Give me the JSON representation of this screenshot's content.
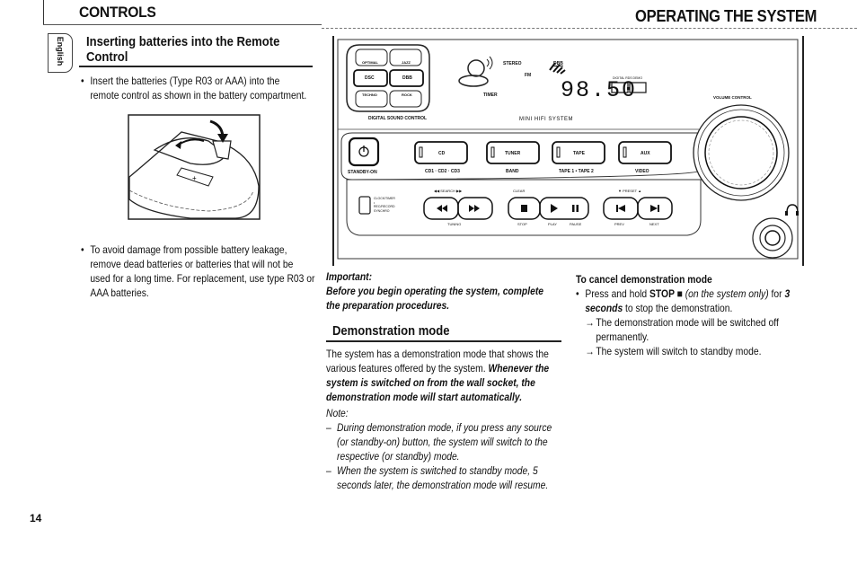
{
  "header": {
    "left_title": "CONTROLS",
    "right_title": "OPERATING THE SYSTEM"
  },
  "language_tab": {
    "label": "English"
  },
  "left_section": {
    "heading_line1": "Inserting batteries into the Remote",
    "heading_line2": "Control",
    "bullet1_line1": "Insert the batteries  (Type R03 or AAA)  into the",
    "bullet1_line2": "remote control as shown in the battery compartment.",
    "illustration_label": "remote-battery-compartment",
    "bullet2_lines": [
      "To avoid damage from possible battery leakage,",
      "remove dead batteries or batteries that will not be",
      "used for a long time. For replacement, use type R03 or",
      "AAA batteries."
    ]
  },
  "device_panel": {
    "dsc_buttons": [
      "OPTIMAL",
      "JAZZ",
      "DSC",
      "DBB",
      "TECHNO",
      "ROCK"
    ],
    "dsc_label": "DIGITAL SOUND CONTROL",
    "display": {
      "stereo": "STEREO",
      "fm": "FM",
      "dbb": "DBB",
      "timer": "TIMER",
      "frequency": "98.50",
      "model_label": "MINI HIFI SYSTEM",
      "small_labels": "DIGITAL  RDS  DEMO"
    },
    "volume_label": "VOLUME CONTROL",
    "source_buttons": [
      {
        "label": "",
        "sublabel": "STANDBY-ON"
      },
      {
        "label": "CD",
        "sublabel": "CD1 · CD2 · CD3"
      },
      {
        "label": "TUNER",
        "sublabel": "BAND"
      },
      {
        "label": "TAPE",
        "sublabel": "TAPE 1 • TAPE 2"
      },
      {
        "label": "AUX",
        "sublabel": "VIDEO"
      }
    ],
    "transport": {
      "search_label": "◀◀  SEARCH  ▶▶",
      "tuning_label": "TUNING",
      "clear_label": "CLEAR",
      "stop_label": "STOP",
      "play_label": "PLAY",
      "pause_label": "PAUSE",
      "preset_label": "▼  PRESET  ▲",
      "prev_label": "PREV",
      "next_label": "NEXT",
      "clock_lines": [
        "CLOCK/TIMER",
        "•",
        "REC/RECORD",
        "SYNCHRO"
      ]
    }
  },
  "important": {
    "title": "Important:",
    "text_line1": "Before you begin operating the system, complete",
    "text_line2": "the preparation procedures."
  },
  "demo": {
    "heading": "Demonstration mode",
    "p1_line1": "The system has a demonstration mode that shows the",
    "p1_line2a": "various features offered by the system.  ",
    "p1_line2b": "Whenever the",
    "p1_line3": "system is switched on from the wall socket, the",
    "p1_line4": "demonstration mode will start automatically.",
    "note_title": "Note:",
    "note1_lines": [
      "During demonstration mode, if you press any source",
      "(or standby-on) button, the system will switch to the",
      "respective (or standby) mode."
    ],
    "note2_lines": [
      "When the system is switched to standby mode, 5",
      "seconds later, the demonstration mode will resume."
    ]
  },
  "cancel": {
    "heading": "To cancel demonstration mode",
    "b1_pre": "Press and hold ",
    "b1_stop": "STOP ■",
    "b1_italic": "(on the system only)",
    "b1_for": " for ",
    "b1_3": "3",
    "b1_seconds": "seconds",
    "b1_rest": " to stop the demonstration.",
    "arrow1_line1": "The demonstration mode will be switched off",
    "arrow1_line2": "permanently.",
    "arrow2": "The system will switch to standby mode."
  },
  "footer": {
    "page_number": "14"
  }
}
